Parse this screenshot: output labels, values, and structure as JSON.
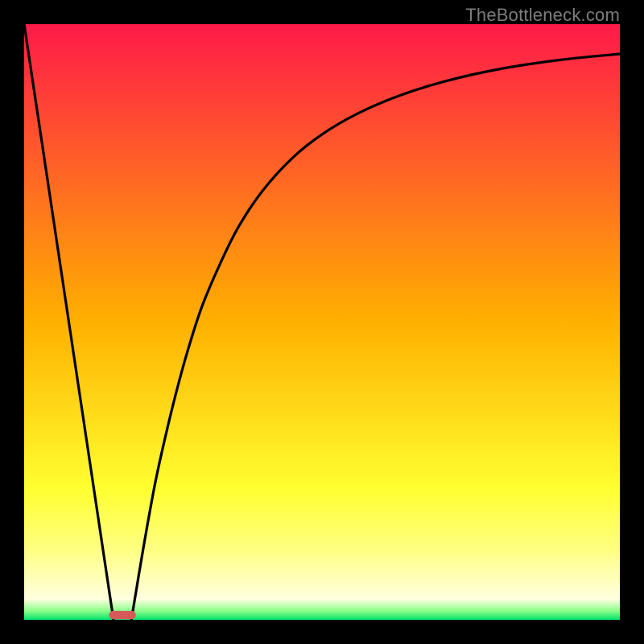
{
  "watermark": "TheBottleneck.com",
  "chart_data": {
    "type": "line",
    "title": "",
    "xlabel": "",
    "ylabel": "",
    "xlim": [
      0,
      100
    ],
    "ylim": [
      0,
      100
    ],
    "grid": false,
    "legend": false,
    "gradient_stops": [
      {
        "offset": 0.0,
        "color": "#ff1a49"
      },
      {
        "offset": 0.5,
        "color": "#ffb000"
      },
      {
        "offset": 0.78,
        "color": "#ffff30"
      },
      {
        "offset": 0.88,
        "color": "#ffff80"
      },
      {
        "offset": 0.965,
        "color": "#ffffe0"
      },
      {
        "offset": 0.985,
        "color": "#8aff8a"
      },
      {
        "offset": 1.0,
        "color": "#00e16a"
      }
    ],
    "series": [
      {
        "name": "left-branch",
        "x": [
          0.0,
          1.2,
          2.4,
          3.6,
          4.8,
          6.0,
          7.2,
          8.4,
          9.6,
          10.8,
          12.0,
          13.2,
          14.4,
          15.0
        ],
        "y": [
          100.0,
          92.0,
          84.0,
          76.0,
          68.0,
          60.0,
          52.0,
          44.0,
          36.0,
          28.0,
          20.0,
          12.0,
          4.0,
          0.0
        ]
      },
      {
        "name": "right-branch",
        "x": [
          18.0,
          20.0,
          22.0,
          24.0,
          26.0,
          28.0,
          30.0,
          33.0,
          36.0,
          40.0,
          45.0,
          50.0,
          56.0,
          63.0,
          71.0,
          80.0,
          90.0,
          100.0
        ],
        "y": [
          0.0,
          12.0,
          23.0,
          32.0,
          40.0,
          47.0,
          53.0,
          60.0,
          66.0,
          72.0,
          77.5,
          81.5,
          85.0,
          88.0,
          90.5,
          92.5,
          94.0,
          95.0
        ]
      }
    ],
    "marker": {
      "x_center": 16.5,
      "y_center": 0.8,
      "width": 4.5,
      "height": 1.4,
      "color": "#d65a5a",
      "rx": 5
    }
  }
}
